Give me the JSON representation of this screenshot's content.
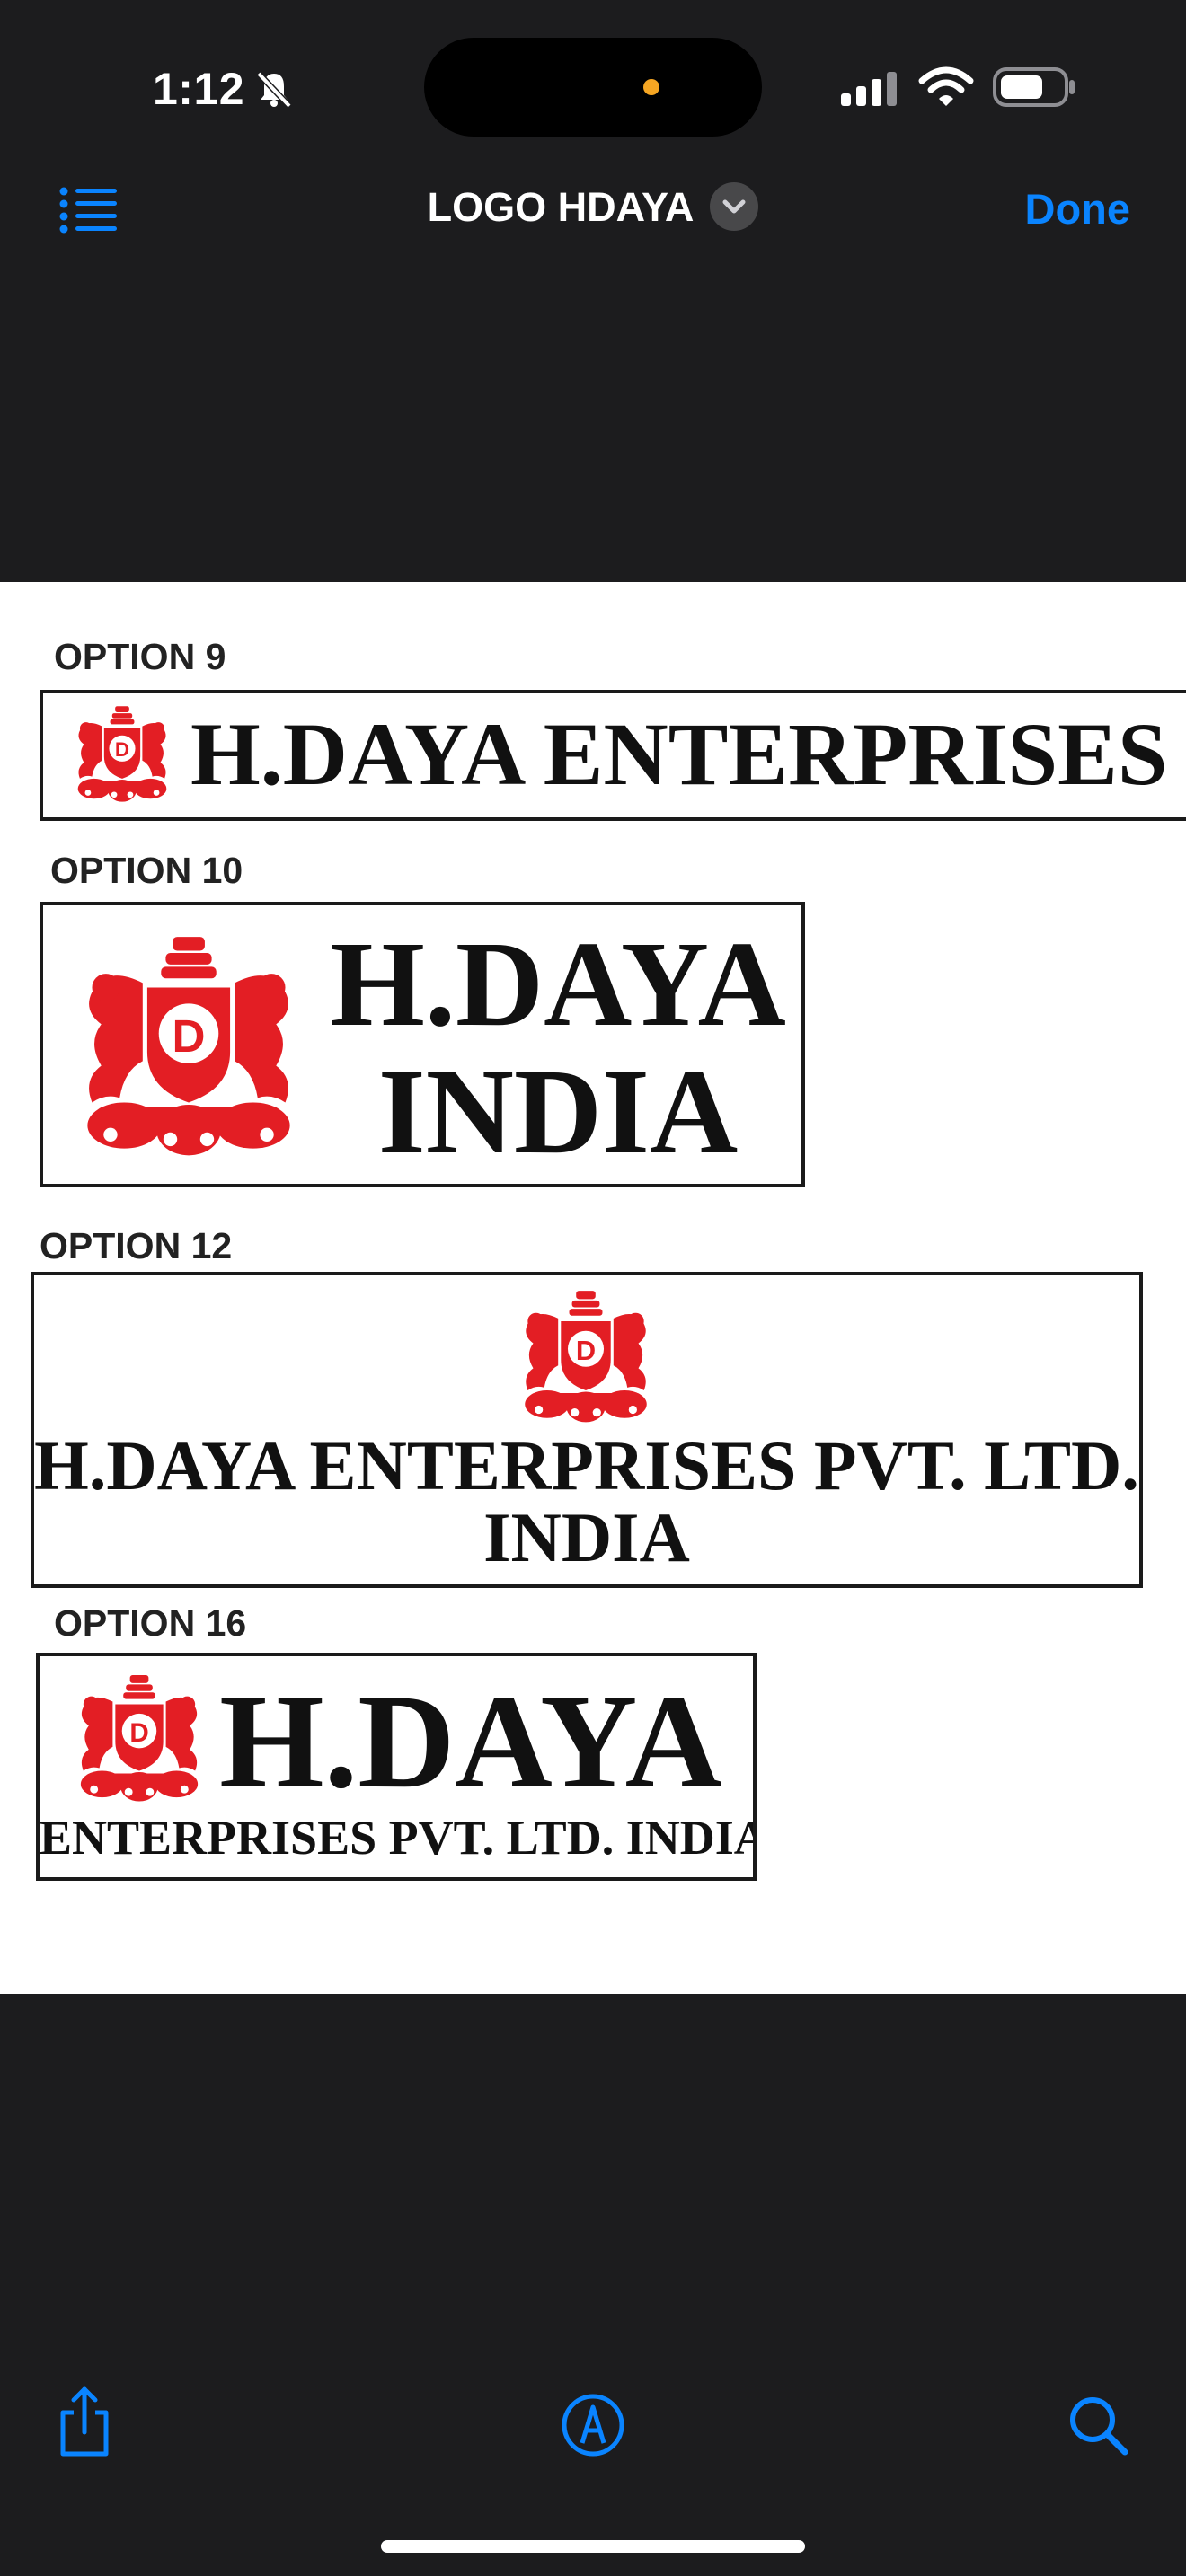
{
  "status_bar": {
    "time": "1:12",
    "icons": [
      "bell-slash-icon",
      "cellular-signal-icon",
      "wifi-icon",
      "battery-icon"
    ]
  },
  "nav": {
    "title": "LOGO HDAYA",
    "done_label": "Done",
    "list_icon": "list-icon",
    "title_menu_icon": "chevron-down-icon"
  },
  "document": {
    "options": [
      {
        "label": "OPTION 9",
        "line1": "H.DAYA ENTERPRISES PVT. LTD."
      },
      {
        "label": "OPTION 10",
        "line1": "H.DAYA",
        "line2": "INDIA"
      },
      {
        "label": "OPTION 12",
        "line1": "H.DAYA ENTERPRISES PVT. LTD.",
        "line2": "INDIA"
      },
      {
        "label": "OPTION 16",
        "line1": "H.DAYA",
        "line2": "ENTERPRISES PVT. LTD. INDIA"
      }
    ],
    "emblem_letter": "D",
    "emblem_color": "#e31e24"
  },
  "toolbar": {
    "icons": [
      "share-icon",
      "markup-icon",
      "search-icon"
    ]
  },
  "colors": {
    "accent": "#0a84ff",
    "background": "#1c1c1e"
  }
}
